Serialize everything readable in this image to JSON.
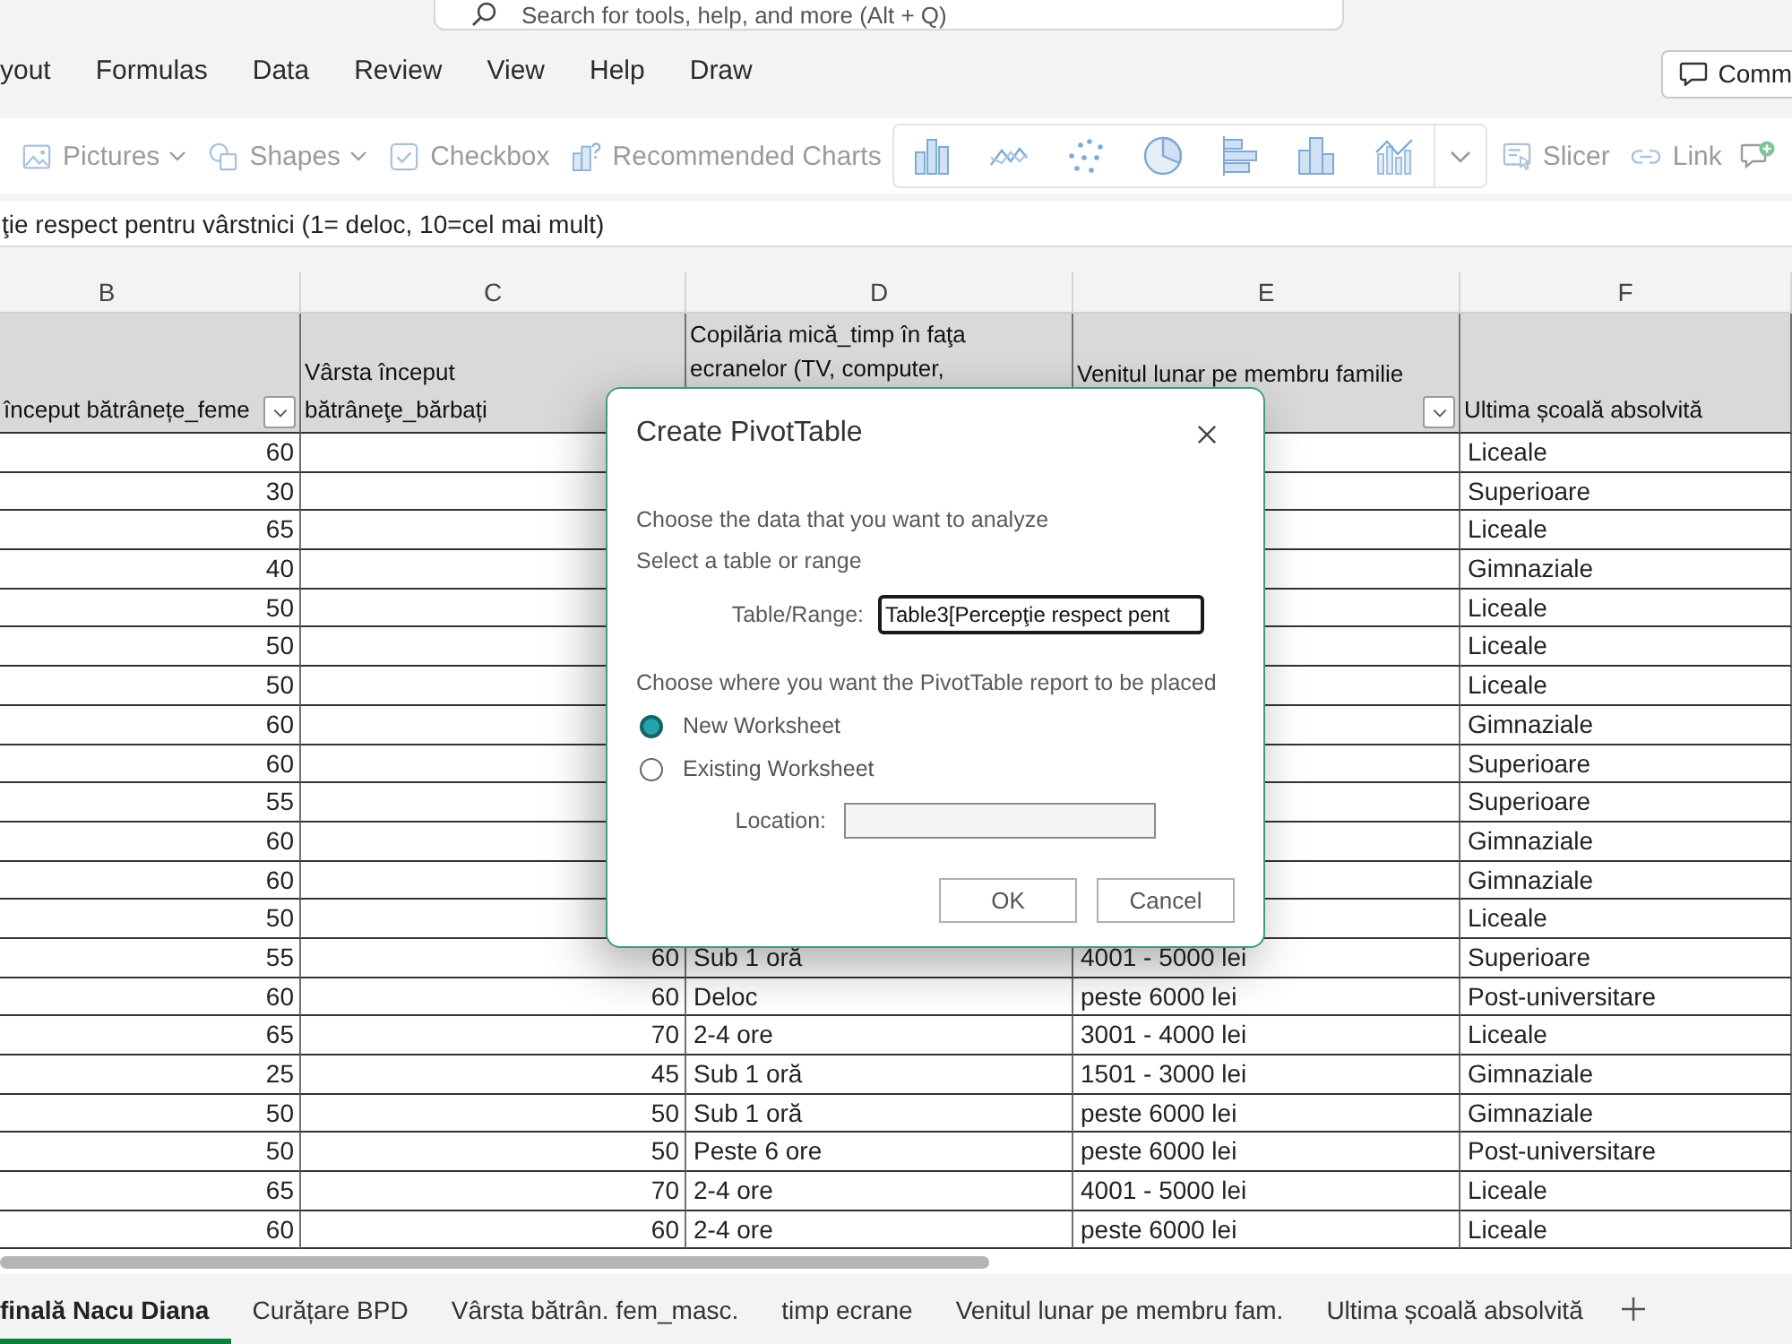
{
  "search": {
    "placeholder": "Search for tools, help, and more (Alt + Q)"
  },
  "menu_tabs": [
    {
      "label": "yout",
      "selected": false
    },
    {
      "label": "Formulas",
      "selected": false
    },
    {
      "label": "Data",
      "selected": false
    },
    {
      "label": "Review",
      "selected": false
    },
    {
      "label": "View",
      "selected": false
    },
    {
      "label": "Help",
      "selected": false
    },
    {
      "label": "Draw",
      "selected": false
    }
  ],
  "comments_button": {
    "label": "Comm"
  },
  "ribbon": {
    "items": [
      {
        "kind": "dropdown",
        "label": "Pictures",
        "disabled": true
      },
      {
        "kind": "dropdown",
        "label": "Shapes",
        "disabled": true
      },
      {
        "kind": "button",
        "label": "Checkbox",
        "disabled": true
      },
      {
        "kind": "button",
        "label": "Recommended Charts",
        "disabled": true
      }
    ],
    "trailing_items": [
      {
        "kind": "button",
        "label": "Slicer",
        "disabled": true
      },
      {
        "kind": "button",
        "label": "Link",
        "disabled": true
      }
    ]
  },
  "formula_bar": {
    "value": "ţie respect pentru vârstnici (1= deloc, 10=cel mai mult)"
  },
  "sheet": {
    "columns": [
      {
        "letter": "B",
        "header": "început bătrânețe_feme",
        "filter": true,
        "kind": "number"
      },
      {
        "letter": "C",
        "header": "Vârsta început\nbătrâneţe_bărbați",
        "filter": false,
        "kind": "number"
      },
      {
        "letter": "D",
        "header": "Copilăria mică_timp în faţa ecranelor (TV, computer,",
        "filter": false,
        "kind": "text"
      },
      {
        "letter": "E",
        "header": "Venitul lunar pe membru familie",
        "filter": true,
        "kind": "text"
      },
      {
        "letter": "F",
        "header": "Ultima școală absolvită",
        "filter": false,
        "kind": "text"
      }
    ],
    "rows": [
      {
        "b": "60",
        "f": "Liceale"
      },
      {
        "b": "30",
        "f": "Superioare"
      },
      {
        "b": "65",
        "f": "Liceale"
      },
      {
        "b": "40",
        "f": "Gimnaziale"
      },
      {
        "b": "50",
        "f": "Liceale"
      },
      {
        "b": "50",
        "f": "Liceale"
      },
      {
        "b": "50",
        "f": "Liceale"
      },
      {
        "b": "60",
        "f": "Gimnaziale"
      },
      {
        "b": "60",
        "f": "Superioare"
      },
      {
        "b": "55",
        "f": "Superioare"
      },
      {
        "b": "60",
        "f": "Gimnaziale"
      },
      {
        "b": "60",
        "f": "Gimnaziale"
      },
      {
        "b": "50",
        "f": "Liceale"
      },
      {
        "b": "55",
        "c": "60",
        "d": "Sub 1 oră",
        "e": "4001 - 5000 lei",
        "f": "Superioare"
      },
      {
        "b": "60",
        "c": "60",
        "d": "Deloc",
        "e": "peste 6000 lei",
        "f": "Post-universitare"
      },
      {
        "b": "65",
        "c": "70",
        "d": "2-4 ore",
        "e": "3001 - 4000 lei",
        "f": "Liceale"
      },
      {
        "b": "25",
        "c": "45",
        "d": "Sub 1 oră",
        "e": "1501 - 3000 lei",
        "f": "Gimnaziale"
      },
      {
        "b": "50",
        "c": "50",
        "d": "Sub 1 oră",
        "e": "peste 6000 lei",
        "f": "Gimnaziale"
      },
      {
        "b": "50",
        "c": "50",
        "d": "Peste 6 ore",
        "e": "peste 6000 lei",
        "f": "Post-universitare"
      },
      {
        "b": "65",
        "c": "70",
        "d": "2-4 ore",
        "e": "4001 - 5000 lei",
        "f": "Liceale"
      },
      {
        "b": "60",
        "c": "60",
        "d": "2-4 ore",
        "e": "peste 6000 lei",
        "f": "Liceale"
      }
    ]
  },
  "dialog": {
    "title": "Create PivotTable",
    "data_prompt": "Choose the data that you want to analyze",
    "range_prompt": "Select a table or range",
    "range_field": {
      "label": "Table/Range:",
      "value": "Table3[Percepţie respect pent"
    },
    "placement_prompt": "Choose where you want the PivotTable report to be placed",
    "options": [
      {
        "label": "New Worksheet",
        "selected": true
      },
      {
        "label": "Existing Worksheet",
        "selected": false
      }
    ],
    "location_field": {
      "label": "Location:",
      "disabled": true
    },
    "buttons": [
      "OK",
      "Cancel"
    ]
  },
  "sheet_tabs": [
    {
      "label": "finală Nacu Diana",
      "selected": true
    },
    {
      "label": "Curățare BPD",
      "selected": false
    },
    {
      "label": "Vârsta bătrân. fem_masc.",
      "selected": false
    },
    {
      "label": "timp ecrane",
      "selected": false
    },
    {
      "label": "Venitul lunar pe membru fam.",
      "selected": false
    },
    {
      "label": "Ultima școală absolvită",
      "selected": false
    }
  ]
}
